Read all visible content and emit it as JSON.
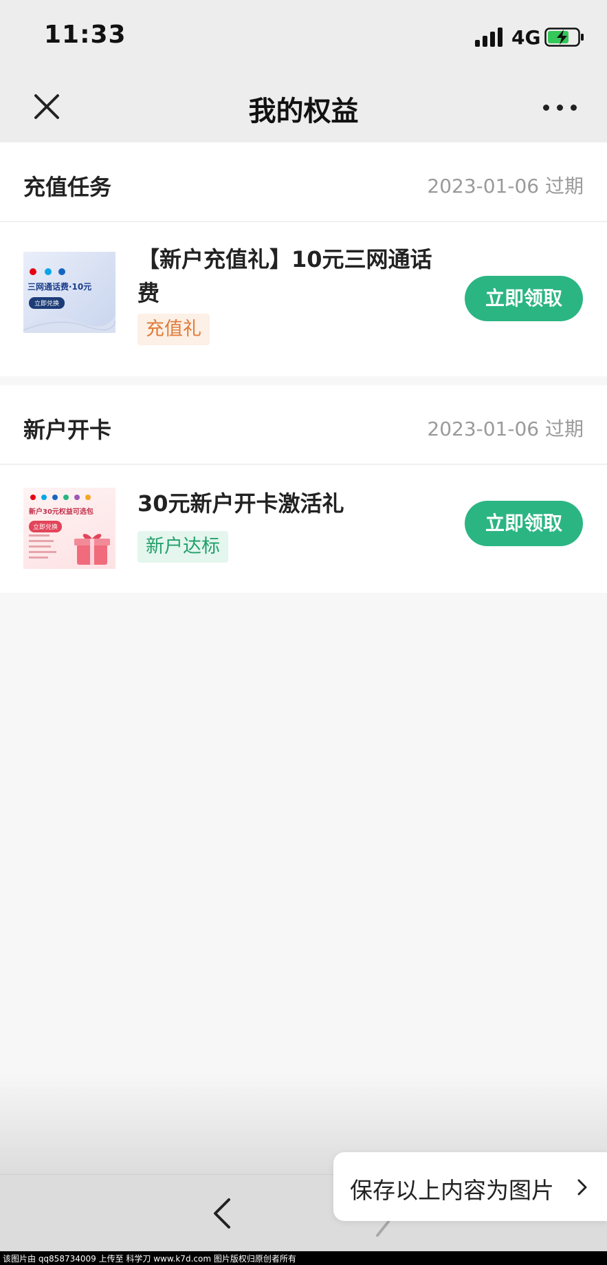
{
  "status_bar": {
    "time": "11:33",
    "network": "4G",
    "icons": [
      "signal-icon",
      "battery-charging-icon"
    ]
  },
  "nav": {
    "title": "我的权益",
    "close_icon": "close-icon",
    "more_icon": "more-icon"
  },
  "sections": [
    {
      "title": "充值任务",
      "expiry": "2023-01-06 过期",
      "item": {
        "name": "【新户充值礼】10元三网通话费",
        "tag": "充值礼",
        "button": "立即领取",
        "thumb": {
          "text": "三网通话费·10元",
          "button": "立即兑换"
        }
      }
    },
    {
      "title": "新户开卡",
      "expiry": "2023-01-06 过期",
      "item": {
        "name": "30元新户开卡激活礼",
        "tag": "新户达标",
        "button": "立即领取",
        "thumb": {
          "text": "新户30元权益可选包",
          "button": "立即兑换"
        }
      }
    }
  ],
  "bottom": {
    "save_label": "保存以上内容为图片",
    "back_icon": "back-arrow-icon",
    "forward_icon": "forward-arrow-icon"
  },
  "watermark": "该图片由 qq858734009 上传至 科学刀 www.k7d.com 图片版权归原创者所有",
  "colors": {
    "accent": "#2bb583",
    "tag_orange_bg": "#fdf0e6",
    "tag_orange_text": "#e07b39",
    "tag_green_bg": "#e4f6ee",
    "tag_green_text": "#22a06b"
  }
}
